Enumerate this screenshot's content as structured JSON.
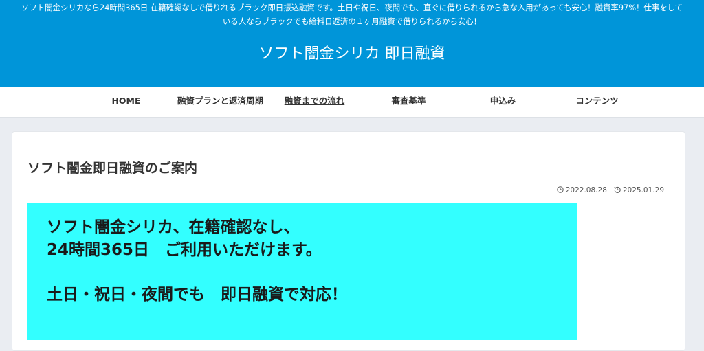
{
  "header": {
    "description": "ソフト闇金シリカなら24時間365日 在籍確認なしで借りれるブラック即日振込融資です。土日や祝日、夜間でも、直ぐに借りられるから急な入用があっても安心！融資率97%！仕事をしている人ならブラックでも給料日返済の１ヶ月融資で借りられるから安心！",
    "site_title": "ソフト闇金シリカ 即日融資",
    "background_color": "#0095d9"
  },
  "nav": {
    "items": [
      {
        "label": "HOME"
      },
      {
        "label": "融資プランと返済周期"
      },
      {
        "label": "融資までの流れ"
      },
      {
        "label": "審査基準"
      },
      {
        "label": "申込み"
      },
      {
        "label": "コンテンツ"
      }
    ]
  },
  "article": {
    "title": "ソフト闇金即日融資のご案内",
    "published": {
      "icon": "clock-icon",
      "date": "2022.08.28"
    },
    "updated": {
      "icon": "history-icon",
      "date": "2025.01.29"
    },
    "banner": {
      "background_color": "#33ffff",
      "line1": "ソフト闇金シリカ、在籍確認なし、",
      "line2": "24時間365日　ご利用いただけます。",
      "line3": "土日・祝日・夜間でも　即日融資で対応！"
    }
  }
}
